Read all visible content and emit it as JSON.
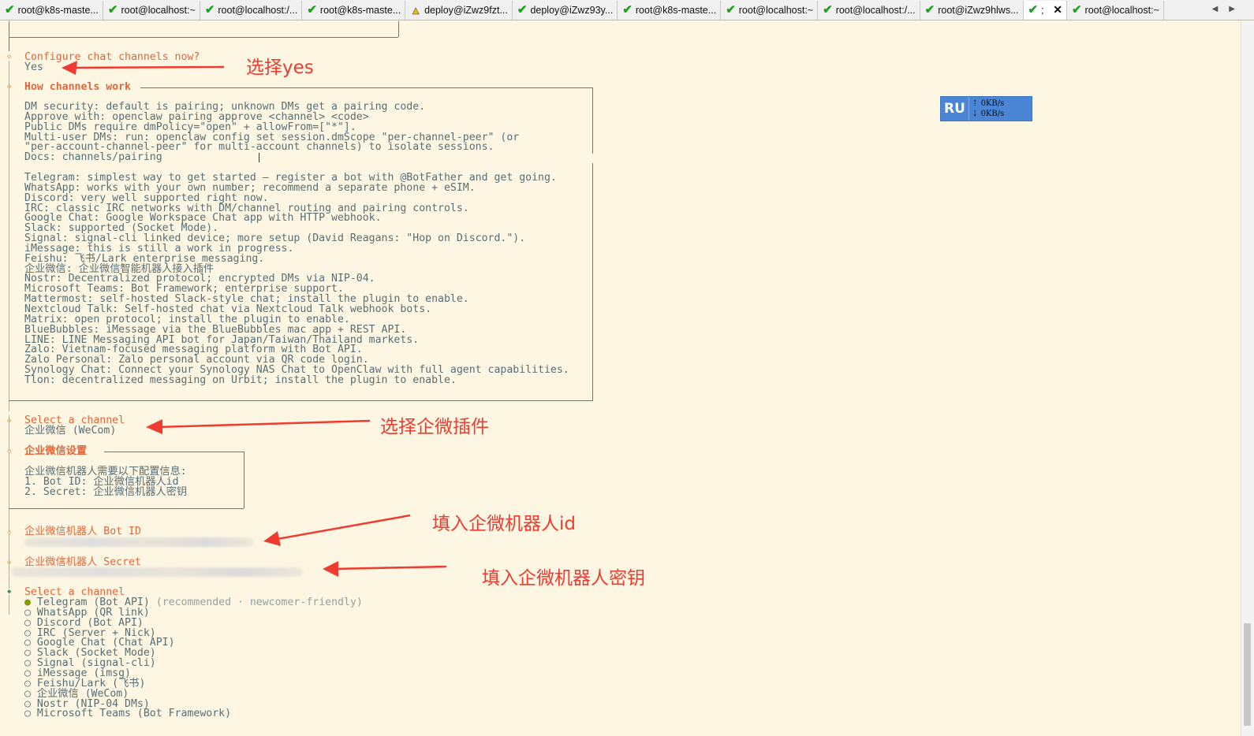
{
  "tabs": [
    {
      "title": "root@k8s-maste...",
      "status": "ok"
    },
    {
      "title": "root@localhost:~",
      "status": "ok"
    },
    {
      "title": "root@localhost:/...",
      "status": "ok"
    },
    {
      "title": "root@k8s-maste...",
      "status": "ok"
    },
    {
      "title": "deploy@iZwz9fzt...",
      "status": "warning"
    },
    {
      "title": "deploy@iZwz93y...",
      "status": "ok"
    },
    {
      "title": "root@k8s-maste...",
      "status": "ok"
    },
    {
      "title": "root@localhost:~",
      "status": "ok"
    },
    {
      "title": "root@localhost:/...",
      "status": "ok"
    },
    {
      "title": "root@iZwz9hlws...",
      "status": "ok"
    },
    {
      "title": ";",
      "status": "ok",
      "active": true
    },
    {
      "title": "root@localhost:~",
      "status": "ok"
    }
  ],
  "terminal": {
    "configure_prompt": "Configure chat channels now?",
    "configure_answer": "Yes",
    "how_title": "How channels work",
    "how_lines": [
      "DM security: default is pairing; unknown DMs get a pairing code.",
      "Approve with: openclaw pairing approve <channel> <code>",
      "Public DMs require dmPolicy=\"open\" + allowFrom=[\"*\"].",
      "Multi-user DMs: run: openclaw config set session.dmScope \"per-channel-peer\" (or",
      "\"per-account-channel-peer\" for multi-account channels) to isolate sessions.",
      "Docs: channels/pairing",
      "",
      "Telegram: simplest way to get started — register a bot with @BotFather and get going.",
      "WhatsApp: works with your own number; recommend a separate phone + eSIM.",
      "Discord: very well supported right now.",
      "IRC: classic IRC networks with DM/channel routing and pairing controls.",
      "Google Chat: Google Workspace Chat app with HTTP webhook.",
      "Slack: supported (Socket Mode).",
      "Signal: signal-cli linked device; more setup (David Reagans: \"Hop on Discord.\").",
      "iMessage: this is still a work in progress.",
      "Feishu: 飞书/Lark enterprise messaging.",
      "企业微信: 企业微信智能机器人接入插件",
      "Nostr: Decentralized protocol; encrypted DMs via NIP-04.",
      "Microsoft Teams: Bot Framework; enterprise support.",
      "Mattermost: self-hosted Slack-style chat; install the plugin to enable.",
      "Nextcloud Talk: Self-hosted chat via Nextcloud Talk webhook bots.",
      "Matrix: open protocol; install the plugin to enable.",
      "BlueBubbles: iMessage via the BlueBubbles mac app + REST API.",
      "LINE: LINE Messaging API bot for Japan/Taiwan/Thailand markets.",
      "Zalo: Vietnam-focused messaging platform with Bot API.",
      "Zalo Personal: Zalo personal account via QR code login.",
      "Synology Chat: Connect your Synology NAS Chat to OpenClaw with full agent capabilities.",
      "Tlon: decentralized messaging on Urbit; install the plugin to enable."
    ],
    "select_channel_1": "Select a channel",
    "selected_channel": "企业微信 (WeCom)",
    "wecom_title": "企业微信设置",
    "wecom_lines": [
      "企业微信机器人需要以下配置信息:",
      "1. Bot ID: 企业微信机器人id",
      "2. Secret: 企业微信机器人密钥"
    ],
    "bot_id_label": "企业微信机器人 Bot ID",
    "secret_label": "企业微信机器人 Secret",
    "select_channel_2": "Select a channel",
    "channel_options": [
      {
        "label": "Telegram (Bot API)",
        "hint": "(recommended · newcomer-friendly)",
        "selected": true
      },
      {
        "label": "WhatsApp (QR link)"
      },
      {
        "label": "Discord (Bot API)"
      },
      {
        "label": "IRC (Server + Nick)"
      },
      {
        "label": "Google Chat (Chat API)"
      },
      {
        "label": "Slack (Socket Mode)"
      },
      {
        "label": "Signal (signal-cli)"
      },
      {
        "label": "iMessage (imsg)"
      },
      {
        "label": "Feishu/Lark (飞书)"
      },
      {
        "label": "企业微信 (WeCom)"
      },
      {
        "label": "Nostr (NIP-04 DMs)"
      },
      {
        "label": "Microsoft Teams (Bot Framework)"
      }
    ]
  },
  "annotations": {
    "choose_yes": "选择yes",
    "choose_wecom": "选择企微插件",
    "fill_bot_id": "填入企微机器人id",
    "fill_secret": "填入企微机器人密钥"
  },
  "net_widget": {
    "logo": "RU",
    "up": "0KB/s",
    "down": "0KB/s"
  },
  "colors": {
    "terminal_bg": "#fdf6e3",
    "terminal_text": "#586e75",
    "prompt_orange": "#e3663a",
    "annotation_red": "#ef3b30",
    "selected_green": "#859900"
  }
}
